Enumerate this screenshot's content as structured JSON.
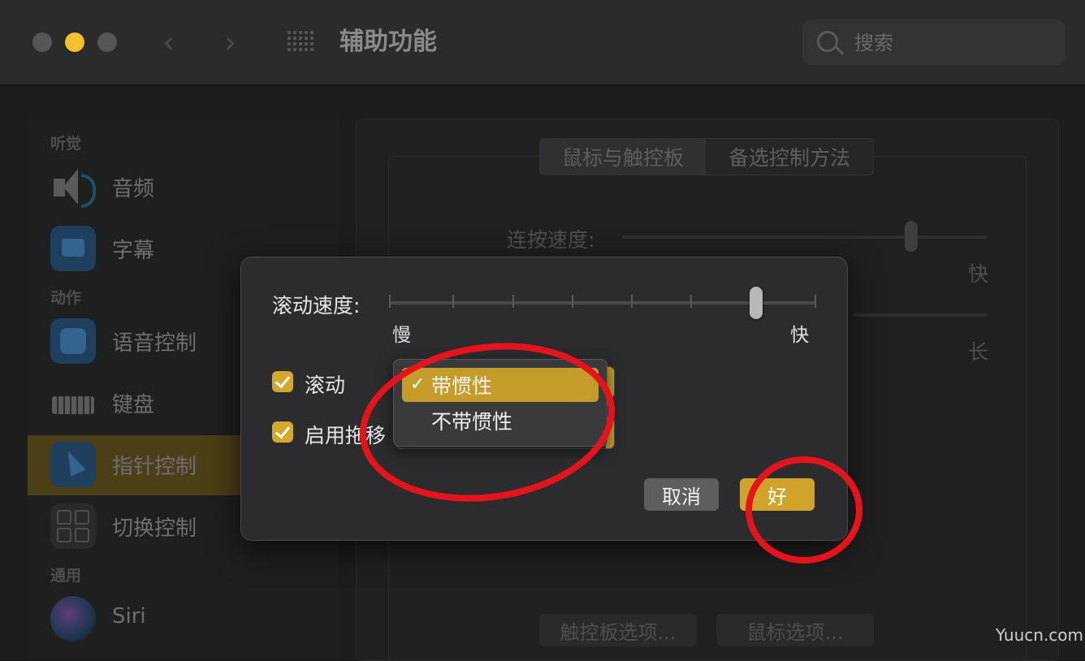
{
  "window": {
    "title": "辅助功能"
  },
  "search": {
    "placeholder": "搜索"
  },
  "sidebar": {
    "sections": [
      "听觉",
      "动作",
      "通用"
    ],
    "items": [
      {
        "label": "音频"
      },
      {
        "label": "字幕"
      },
      {
        "label": "语音控制"
      },
      {
        "label": "键盘"
      },
      {
        "label": "指针控制",
        "selected": true
      },
      {
        "label": "切换控制"
      },
      {
        "label": "Siri"
      }
    ]
  },
  "pane": {
    "tabs": [
      "鼠标与触控板",
      "备选控制方法"
    ],
    "double_click_label": "连按速度:",
    "fast": "快",
    "long": "长",
    "trackpad_button": "触控板选项...",
    "mouse_button": "鼠标选项..."
  },
  "sheet": {
    "scroll_speed_label": "滚动速度:",
    "slow": "慢",
    "fast": "快",
    "scroll_speed_level": 0.86,
    "scroll_checkbox": "滚动",
    "drag_checkbox": "启用拖移",
    "cancel": "取消",
    "ok": "好"
  },
  "menu": {
    "items": [
      {
        "label": "带惯性",
        "checked": true
      },
      {
        "label": "不带惯性",
        "checked": false
      }
    ],
    "checkmark": "✓"
  },
  "watermark": "Yuucn.com",
  "colors": {
    "accent": "#d1a32b",
    "annotation": "#e5141c"
  }
}
